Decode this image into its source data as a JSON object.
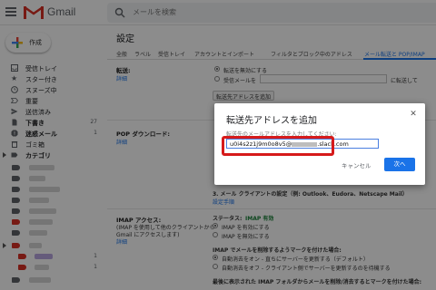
{
  "app": {
    "name": "Gmail",
    "search_placeholder": "メールを検索"
  },
  "sidebar": {
    "compose_label": "作成",
    "items": [
      {
        "label": "受信トレイ",
        "count": "",
        "icon": "inbox-icon",
        "bold": false
      },
      {
        "label": "スター付き",
        "count": "",
        "icon": "star-icon",
        "bold": false
      },
      {
        "label": "スヌーズ中",
        "count": "",
        "icon": "clock-icon",
        "bold": false
      },
      {
        "label": "重要",
        "count": "",
        "icon": "important-icon",
        "bold": false
      },
      {
        "label": "送信済み",
        "count": "",
        "icon": "send-icon",
        "bold": false
      },
      {
        "label": "下書き",
        "count": "27",
        "icon": "draft-icon",
        "bold": true
      },
      {
        "label": "迷惑メール",
        "count": "1",
        "icon": "spam-icon",
        "bold": true
      },
      {
        "label": "ゴミ箱",
        "count": "",
        "icon": "trash-icon",
        "bold": false
      },
      {
        "label": "カテゴリ",
        "count": "",
        "icon": "category-icon",
        "bold": true
      }
    ],
    "labels": [
      {
        "color": "#5f6368",
        "count": ""
      },
      {
        "color": "#5f6368",
        "count": ""
      },
      {
        "color": "#5f6368",
        "count": ""
      },
      {
        "color": "#5f6368",
        "count": ""
      },
      {
        "color": "#5f6368",
        "count": ""
      },
      {
        "color": "#d93025",
        "count": ""
      },
      {
        "color": "#5f6368",
        "count": ""
      },
      {
        "color": "#d93025",
        "count": "1"
      },
      {
        "color": "#d93025",
        "count": "1"
      },
      {
        "color": "#5f6368",
        "count": ""
      }
    ]
  },
  "settings": {
    "title": "設定",
    "tabs": [
      "全般",
      "ラベル",
      "受信トレイ",
      "アカウントとインポート",
      "フィルタとブロック中のアドレス",
      "メール転送と POP/IMAP"
    ],
    "forward_label": "転送:",
    "forward_detail_link": "詳細",
    "forward_disable": "転送を無効にする",
    "forward_enable": "受信メールを",
    "forward_enable_tail": "に転送して",
    "add_forward_button": "転送先アドレスを追加",
    "pop_label": "POP ダウンロード:",
    "pop_detail_link": "詳細",
    "client_config": "3. メール クライアントの設定（例: Outlook、Eudora、Netscape Mail）",
    "setup_link": "設定手順",
    "imap_label": "IMAP アクセス:",
    "imap_desc_1": "(IMAP を使用して他のクライアントから",
    "imap_desc_2": "Gmail にアクセスします)",
    "imap_detail_link": "詳細",
    "status_label": "ステータス:",
    "status_value": "IMAP 有効",
    "imap_enable": "IMAP を有効にする",
    "imap_disable": "IMAP を無効にする",
    "delete_heading": "IMAP でメールを削除するようマークを付けた場合:",
    "auto_expunge_on": "自動消去をオン - 直ちにサーバーを更新する（デフォルト）",
    "auto_expunge_off": "自動消去をオフ - クライアント側でサーバーを更新するのを待機する",
    "bottom_text": "最後に表示された IMAP フォルダからメールを削除/消去するとマークを付けた場合:"
  },
  "dialog": {
    "title": "転送先アドレスを追加",
    "prompt": "転送先のメールアドレスを入力してください:",
    "email_value": "u0i4s2z1j9m0o8v5@",
    "email_suffix": ".slack.com",
    "cancel_label": "キャンセル",
    "next_label": "次へ"
  },
  "colors": {
    "accent": "#1a73e8",
    "highlight": "#d61a1a",
    "status_green": "#188038"
  }
}
